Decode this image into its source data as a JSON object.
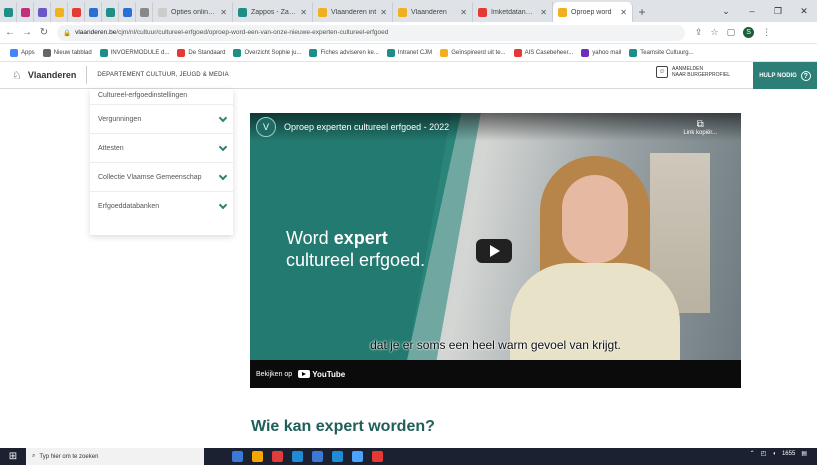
{
  "browser": {
    "tabs": [
      {
        "title": "",
        "color": "#1d8f86",
        "pinned": true
      },
      {
        "title": "",
        "color": "#c0307c",
        "pinned": true
      },
      {
        "title": "",
        "color": "#6b57c7",
        "pinned": true
      },
      {
        "title": "",
        "color": "#f2b01e",
        "pinned": true
      },
      {
        "title": "",
        "color": "#e53935",
        "pinned": true
      },
      {
        "title": "",
        "color": "#2a6fd6",
        "pinned": true
      },
      {
        "title": "",
        "color": "#1d8f86",
        "pinned": true
      },
      {
        "title": "",
        "color": "#2a6fd6",
        "pinned": true
      },
      {
        "title": "",
        "color": "#888888",
        "pinned": true
      },
      {
        "title": "Opties online te",
        "color": "#cccccc",
        "pinned": false
      },
      {
        "title": "Zappos - Zapp",
        "color": "#1d8f86",
        "pinned": false
      },
      {
        "title": "Vlaanderen int",
        "color": "#f2b01e",
        "pinned": false
      },
      {
        "title": "Vlaanderen",
        "color": "#f2b01e",
        "pinned": false
      },
      {
        "title": "Imketdatanorm",
        "color": "#e53935",
        "pinned": false
      },
      {
        "title": "Oproep word",
        "color": "#f2b01e",
        "pinned": false,
        "active": true
      }
    ],
    "new_tab": "+",
    "window_controls": [
      "⌄",
      "–",
      "❐",
      "✕"
    ],
    "url_host": "vlaanderen.be",
    "url_path": "/cjm/nl/cultuur/cultureel-erfgoed/oproep-word-een-van-onze-nieuwe-experten-cultureel-erfgoed",
    "bookmarks": [
      {
        "label": "Apps",
        "color": "#4285f4"
      },
      {
        "label": "Nieuw tabblad",
        "color": "#666666"
      },
      {
        "label": "INVOERMODULE d...",
        "color": "#1d8f86"
      },
      {
        "label": "De Standaard",
        "color": "#e53935"
      },
      {
        "label": "Overzicht Sophie ju...",
        "color": "#1d8f86"
      },
      {
        "label": "Fiches adviseren ke...",
        "color": "#1d8f86"
      },
      {
        "label": "Intranet CJM",
        "color": "#1d8f86"
      },
      {
        "label": "Geïnspireerd uit te...",
        "color": "#f2b01e"
      },
      {
        "label": "AIS Casebeheer...",
        "color": "#e53935"
      },
      {
        "label": "yahoo mail",
        "color": "#6b2fbf"
      },
      {
        "label": "Teamsite Cultuurg...",
        "color": "#1d8f86"
      }
    ]
  },
  "site": {
    "brand": "Vlaanderen",
    "department": "DEPARTEMENT CULTUUR, JEUGD & MEDIA",
    "login_line1": "AANMELDEN",
    "login_line2": "NAAR BURGERPROFIEL",
    "help": "HULP NODIG"
  },
  "sidebar": {
    "items": [
      {
        "label": "Cultureel-erfgoedinstellingen",
        "chevron": false
      },
      {
        "label": "Vergunningen",
        "chevron": true
      },
      {
        "label": "Attesten",
        "chevron": true
      },
      {
        "label": "Collectie Vlaamse Gemeenschap",
        "chevron": true
      },
      {
        "label": "Erfgoeddatabanken",
        "chevron": true
      }
    ]
  },
  "video": {
    "title": "Oproep experten cultureel erfgoed - 2022",
    "copy_link": "Link kopiër...",
    "headline_prefix": "Word ",
    "headline_bold": "expert",
    "headline_line2": "cultureel erfgoed.",
    "caption": "dat je er soms een heel warm gevoel van krijgt.",
    "watch_on": "Bekijken op",
    "youtube": "YouTube"
  },
  "main": {
    "heading": "Wie kan expert worden?"
  },
  "taskbar": {
    "search_placeholder": "Typ hier om te zoeken",
    "clock": "1655",
    "apps": [
      "#3b78d8",
      "#f2a800",
      "#e23b3b",
      "#1f8bd6",
      "#3b78d8",
      "#1f8bd6",
      "#4aa3ff",
      "#e53935"
    ]
  }
}
